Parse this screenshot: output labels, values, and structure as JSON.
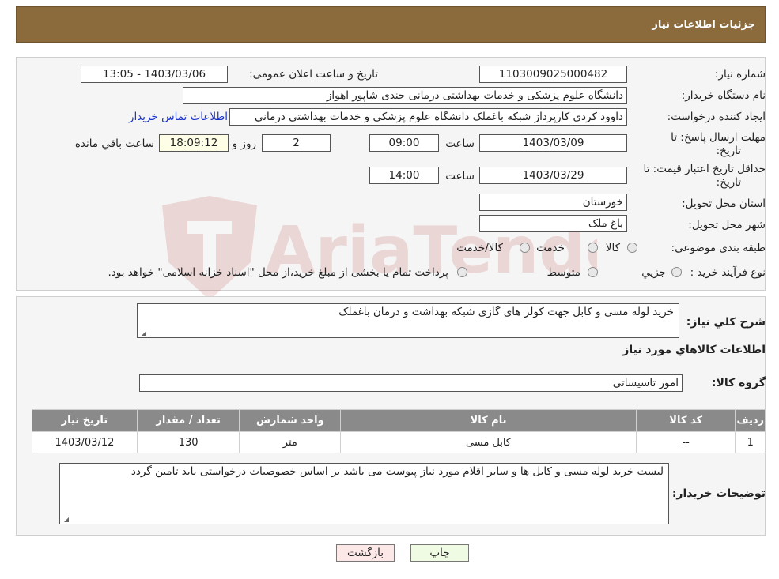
{
  "header": {
    "title": "جزئیات اطلاعات نیاز"
  },
  "form": {
    "need_number_label": "شماره نیاز:",
    "need_number": "1103009025000482",
    "announce_label": "تاریخ و ساعت اعلان عمومی:",
    "announce_value": "1403/03/06 - 13:05",
    "buyer_org_label": "نام دستگاه خریدار:",
    "buyer_org": "دانشگاه علوم پزشکی و خدمات بهداشتی درمانی جندی شاپور اهواز",
    "creator_label": "ایجاد کننده درخواست:",
    "creator": "داوود کردی کارپرداز شبکه باغملک دانشگاه علوم پزشکی و خدمات بهداشتی درمانی",
    "contact_link": "اطلاعات تماس خریدار",
    "deadline_label_1": "مهلت ارسال پاسخ: تا",
    "deadline_label_2": "تاریخ:",
    "deadline_date": "1403/03/09",
    "time_label": "ساعت",
    "deadline_time": "09:00",
    "days_value": "2",
    "days_label": "روز و",
    "remaining_time": "18:09:12",
    "remaining_label": "ساعت باقي مانده",
    "validity_label_1": "حداقل تاریخ اعتبار قیمت: تا",
    "validity_label_2": "تاریخ:",
    "validity_date": "1403/03/29",
    "validity_time_label": "ساعت",
    "validity_time": "14:00",
    "province_label": "استان محل تحویل:",
    "province": "خوزستان",
    "city_label": "شهر محل تحویل:",
    "city": "باغ ملک",
    "category_label": "طبقه بندی موضوعی:",
    "category_options": [
      "کالا",
      "خدمت",
      "کالا/خدمت"
    ],
    "process_label": "نوع فرآیند خرید :",
    "process_options": [
      "جزیي",
      "متوسط"
    ],
    "payment_note": "پرداخت تمام یا بخشی از مبلغ خرید،از محل \"اسناد خزانه اسلامی\" خواهد بود."
  },
  "details": {
    "desc_label": "شرح کلي نياز:",
    "desc_value": "خرید لوله مسی و کابل جهت کولر های گازی شبکه بهداشت و درمان باغملک",
    "goods_title": "اطلاعات کالاهاي مورد نياز",
    "group_label": "گروه کالا:",
    "group_value": "امور تاسیساتی",
    "table": {
      "headers": [
        "ردیف",
        "کد کالا",
        "نام کالا",
        "واحد شمارش",
        "تعداد / مقدار",
        "تاریخ نیاز"
      ],
      "rows": [
        [
          "1",
          "--",
          "کابل مسی",
          "متر",
          "130",
          "1403/03/12"
        ]
      ]
    },
    "buyer_notes_label": "توضیحات خریدار:",
    "buyer_notes": "لیست خرید لوله مسی و کابل ها و سایر اقلام مورد نیاز پیوست می باشد بر اساس خصوصیات درخواستی باید تامین گردد"
  },
  "buttons": {
    "print": "چاپ",
    "back": "بازگشت"
  },
  "watermark": {
    "text": "AriaTender.neT"
  }
}
